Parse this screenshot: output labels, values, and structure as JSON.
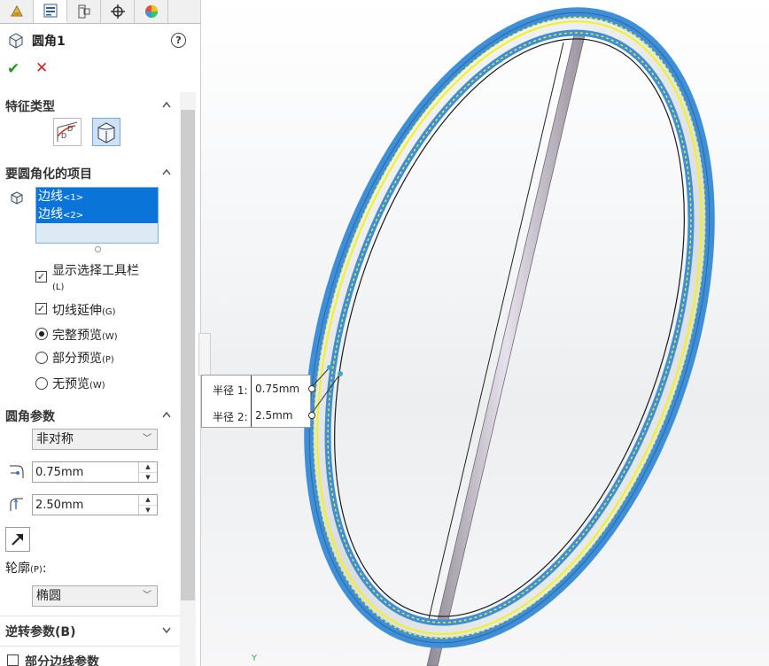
{
  "tabs": [
    "feature-manager-icon",
    "property-manager-icon",
    "configuration-manager-icon",
    "dimxpert-icon",
    "display-manager-icon"
  ],
  "title": "圆角1",
  "help": "?",
  "ok_symbol": "✔",
  "cancel_symbol": "✕",
  "sections": {
    "feature_type": "特征类型",
    "items_to_fillet": "要圆角化的项目",
    "fillet_params": "圆角参数",
    "reverse_params": "逆转参数(B)",
    "partial_edge_params": "部分边线参数"
  },
  "selected_items": [
    {
      "label": "边线",
      "suffix": "<1>"
    },
    {
      "label": "边线",
      "suffix": "<2>"
    }
  ],
  "options": {
    "show_selection_toolbar": {
      "label": "显示选择工具栏",
      "key": "(L)",
      "checked": true
    },
    "tangent_propagation": {
      "label": "切线延伸",
      "key": "(G)",
      "checked": true
    },
    "full_preview": {
      "label": "完整预览",
      "key": "(W)",
      "selected": true
    },
    "partial_preview": {
      "label": "部分预览",
      "key": "(P)",
      "selected": false
    },
    "no_preview": {
      "label": "无预览",
      "key": "(W)",
      "selected": false
    }
  },
  "fillet_method": "非对称",
  "distance1": "0.75mm",
  "distance2": "2.50mm",
  "profile_label": "轮廓",
  "profile_key": "(P)",
  "profile_suffix": ":",
  "profile": "椭圆",
  "callout": {
    "row1_label": "半径 1:",
    "row1_value": "0.75mm",
    "row2_label": "半径 2:",
    "row2_value": "2.5mm"
  },
  "triad_label": "Y",
  "colors": {
    "accent": "#0a74d8",
    "selection_blue": "#3f8fd8",
    "highlight_yellow": "#f2f21e"
  }
}
